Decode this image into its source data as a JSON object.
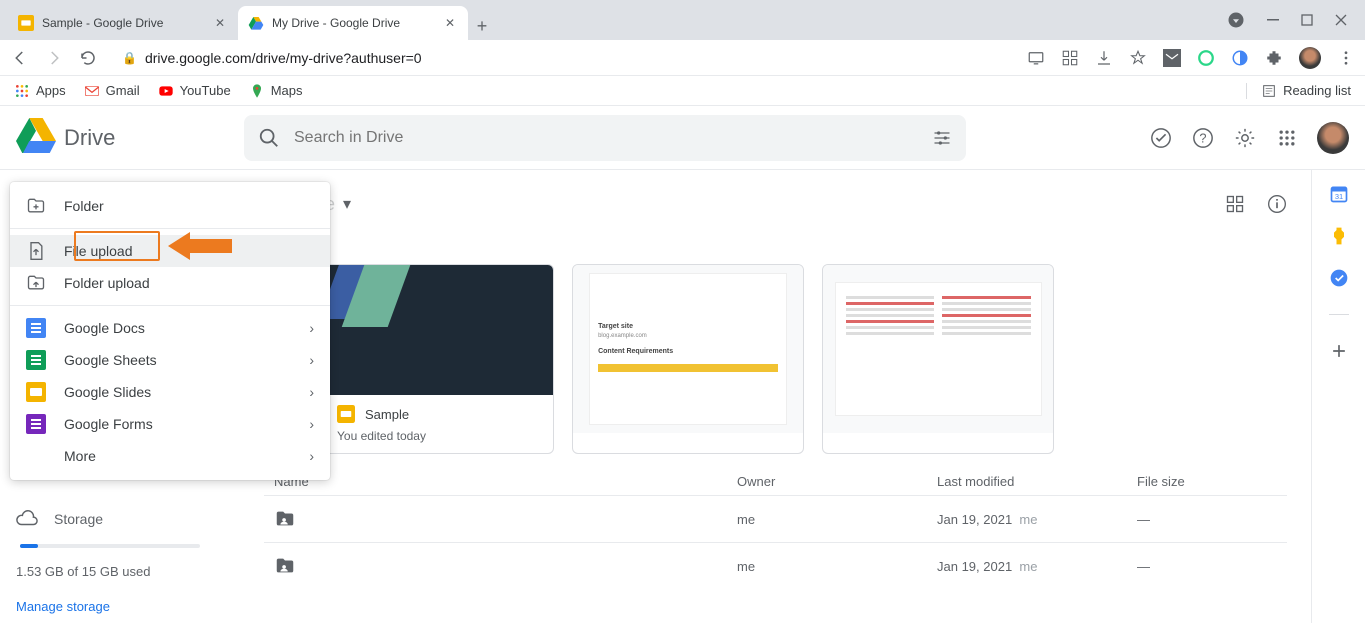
{
  "tabs": [
    {
      "title": "Sample - Google Drive",
      "active": false
    },
    {
      "title": "My Drive - Google Drive",
      "active": true
    }
  ],
  "url": "drive.google.com/drive/my-drive?authuser=0",
  "bookmarks": {
    "apps": "Apps",
    "gmail": "Gmail",
    "youtube": "YouTube",
    "maps": "Maps",
    "reading_list": "Reading list"
  },
  "brand": "Drive",
  "search": {
    "placeholder": "Search in Drive"
  },
  "path": {
    "label": "My Drive"
  },
  "new_menu": {
    "folder": "Folder",
    "file_upload": "File upload",
    "folder_upload": "Folder upload",
    "docs": "Google Docs",
    "sheets": "Google Sheets",
    "slides": "Google Slides",
    "forms": "Google Forms",
    "more": "More"
  },
  "cards": {
    "sample": {
      "title": "Sample",
      "sub": "You edited today"
    }
  },
  "list": {
    "headers": {
      "name": "Name",
      "owner": "Owner",
      "modified": "Last modified",
      "size": "File size"
    },
    "rows": [
      {
        "owner": "me",
        "modified": "Jan 19, 2021",
        "by": "me",
        "size": "—"
      },
      {
        "owner": "me",
        "modified": "Jan 19, 2021",
        "by": "me",
        "size": "—"
      }
    ]
  },
  "storage": {
    "label": "Storage",
    "used_text": "1.53 GB of 15 GB used",
    "manage": "Manage storage"
  }
}
